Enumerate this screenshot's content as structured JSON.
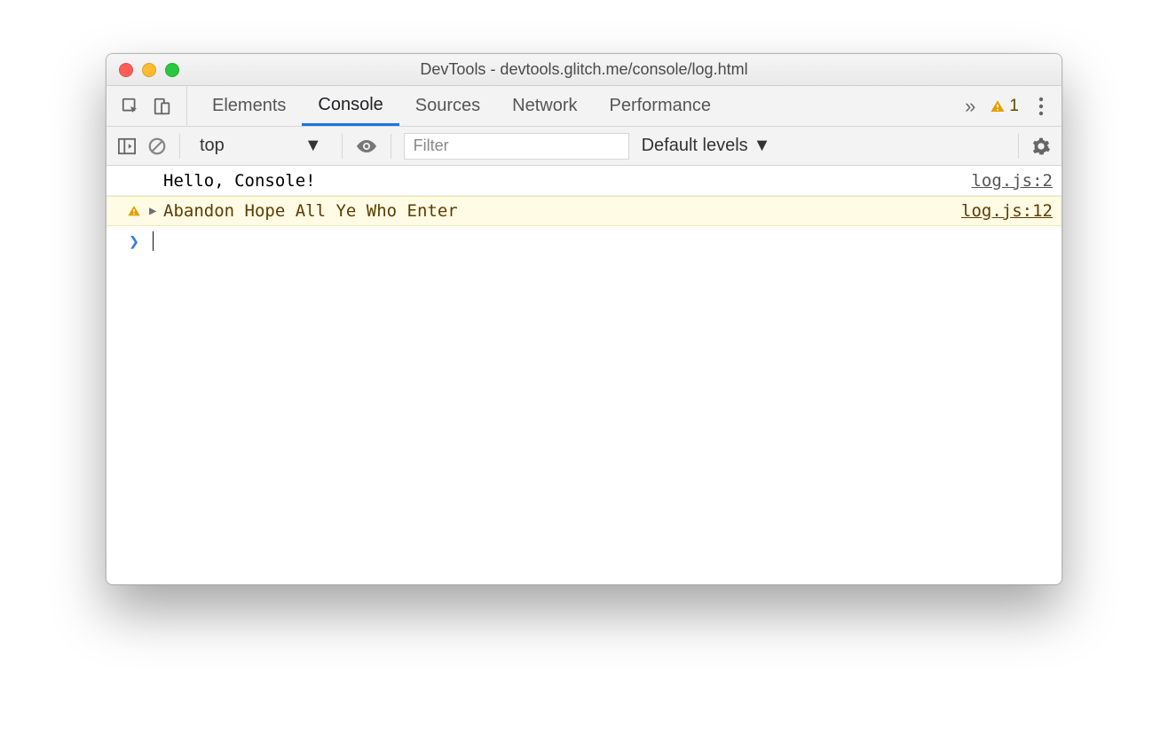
{
  "window": {
    "title": "DevTools - devtools.glitch.me/console/log.html"
  },
  "tabs": {
    "items": [
      "Elements",
      "Console",
      "Sources",
      "Network",
      "Performance"
    ],
    "active_index": 1,
    "warning_count": "1"
  },
  "toolbar": {
    "context": "top",
    "filter_placeholder": "Filter",
    "levels_label": "Default levels"
  },
  "console": {
    "rows": [
      {
        "type": "log",
        "message": "Hello, Console!",
        "source": "log.js:2"
      },
      {
        "type": "warn",
        "message": "Abandon Hope All Ye Who Enter",
        "source": "log.js:12"
      }
    ]
  }
}
